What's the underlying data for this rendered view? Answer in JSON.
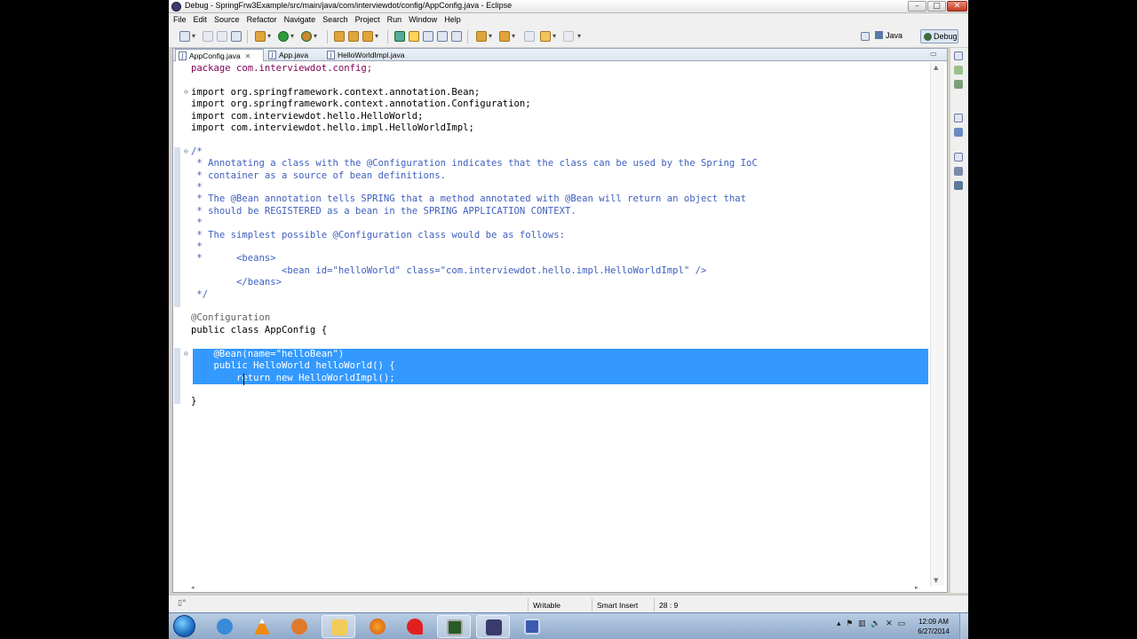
{
  "window": {
    "title": "Debug - SpringFrw3Example/src/main/java/com/interviewdot/config/AppConfig.java - Eclipse",
    "minimize": "–",
    "maximize": "□",
    "close": "✕"
  },
  "menu": [
    "File",
    "Edit",
    "Source",
    "Refactor",
    "Navigate",
    "Search",
    "Project",
    "Run",
    "Window",
    "Help"
  ],
  "perspectives": {
    "java": "Java",
    "debug": "Debug"
  },
  "tabs": [
    {
      "label": "AppConfig.java",
      "active": true,
      "close": "✕"
    },
    {
      "label": "App.java",
      "active": false
    },
    {
      "label": "HelloWorldImpl.java",
      "active": false
    }
  ],
  "code": {
    "l01": "package com.interviewdot.config;",
    "l03": "import org.springframework.context.annotation.Bean;",
    "l04": "import org.springframework.context.annotation.Configuration;",
    "l05": "import com.interviewdot.hello.HelloWorld;",
    "l06": "import com.interviewdot.hello.impl.HelloWorldImpl;",
    "l08": "/*",
    "l09": " * Annotating a class with the @Configuration indicates that the class can be used by the Spring IoC",
    "l10": " * container as a source of bean definitions.",
    "l11": " *",
    "l12": " * The @Bean annotation tells SPRING that a method annotated with @Bean will return an object that",
    "l13": " * should be REGISTERED as a bean in the SPRING APPLICATION CONTEXT.",
    "l14": " *",
    "l15": " * The simplest possible @Configuration class would be as follows:",
    "l16": " *",
    "l17": " *      <beans>",
    "l18": "                <bean id=\"helloWorld\" class=\"com.interviewdot.hello.impl.HelloWorldImpl\" />",
    "l19": "        </beans>",
    "l20": " */",
    "l22": "@Configuration",
    "l23": "public class AppConfig {",
    "l25": "    @Bean(name=\"helloBean\")",
    "l26": "    public HelloWorld helloWorld() {",
    "l27": "        return new HelloWorldImpl();",
    "l28": "    }",
    "l29": "}"
  },
  "status": {
    "mode": "Writable",
    "insert": "Smart Insert",
    "position": "28 : 9"
  },
  "taskbar": {
    "time": "12:09 AM",
    "date": "6/27/2014"
  },
  "colors": {
    "keyword": "#7f0055",
    "comment": "#3f5fbf",
    "annotation": "#646464",
    "string": "#2a00ff",
    "selection": "#3399ff"
  }
}
